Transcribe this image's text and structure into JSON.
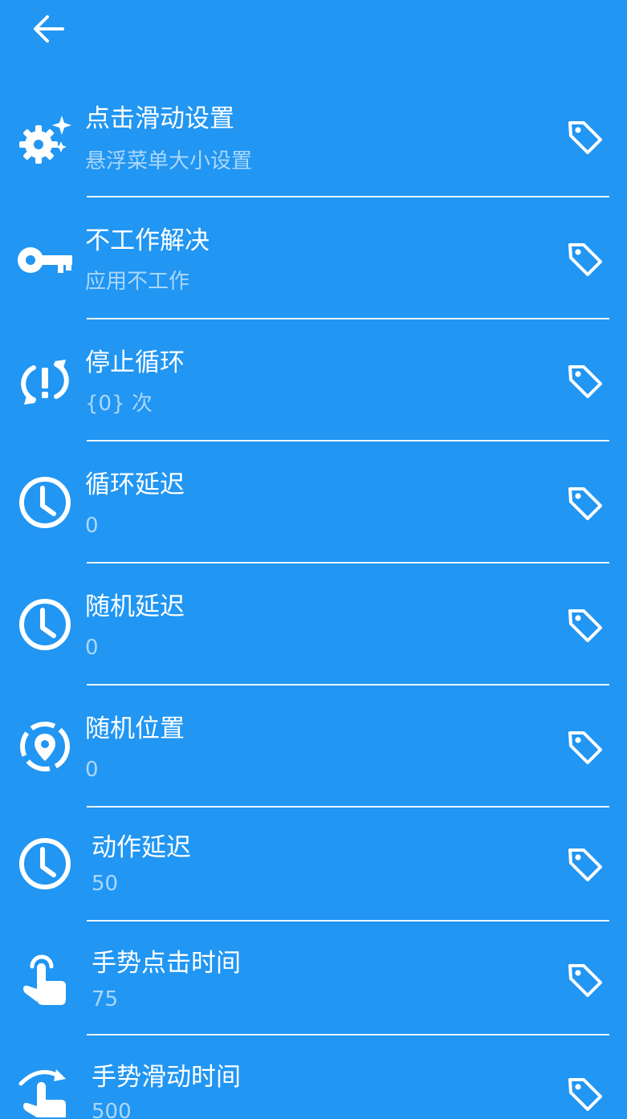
{
  "header": {
    "back_icon": "arrow-left-icon"
  },
  "items": [
    {
      "id": "click-swipe-settings",
      "title": "点击滑动设置",
      "subtitle": "悬浮菜单大小设置",
      "icon": "gears-icon",
      "action_icon": "tag-icon"
    },
    {
      "id": "not-working-fix",
      "title": "不工作解决",
      "subtitle": "应用不工作",
      "icon": "key-icon",
      "action_icon": "tag-icon"
    },
    {
      "id": "stop-loop",
      "title": "停止循环",
      "subtitle": "{0} 次",
      "icon": "loop-alert-icon",
      "action_icon": "tag-icon"
    },
    {
      "id": "loop-delay",
      "title": "循环延迟",
      "subtitle": "0",
      "icon": "clock-icon",
      "action_icon": "tag-icon"
    },
    {
      "id": "random-delay",
      "title": "随机延迟",
      "subtitle": "0",
      "icon": "clock-icon",
      "action_icon": "tag-icon"
    },
    {
      "id": "random-position",
      "title": "随机位置",
      "subtitle": "0",
      "icon": "location-dashed-icon",
      "action_icon": "tag-icon"
    },
    {
      "id": "action-delay",
      "title": "动作延迟",
      "subtitle": "50",
      "icon": "clock-icon",
      "action_icon": "tag-icon"
    },
    {
      "id": "gesture-tap-time",
      "title": "手势点击时间",
      "subtitle": "75",
      "icon": "hand-tap-icon",
      "action_icon": "tag-icon"
    },
    {
      "id": "gesture-swipe-time",
      "title": "手势滑动时间",
      "subtitle": "500",
      "icon": "hand-swipe-icon",
      "action_icon": "tag-icon"
    }
  ]
}
